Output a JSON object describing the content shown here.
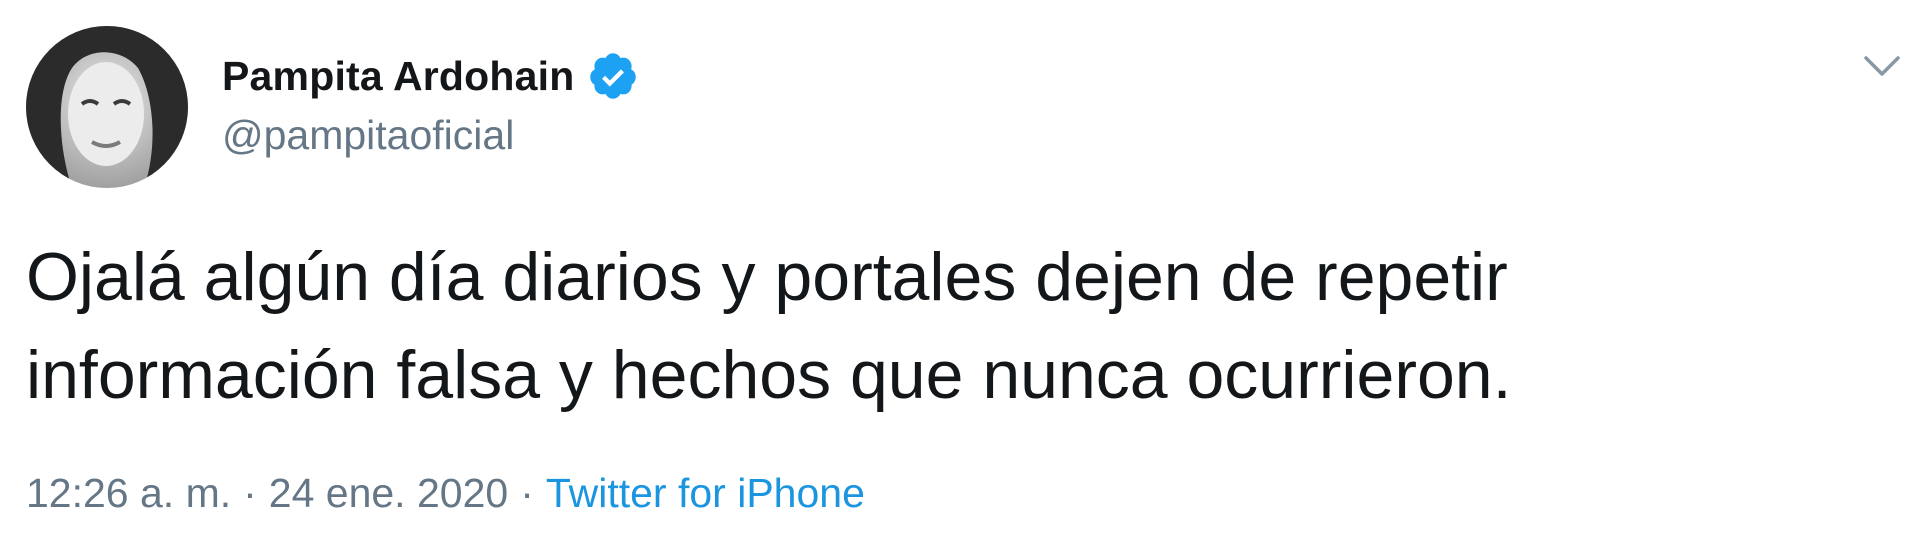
{
  "user": {
    "display_name": "Pampita Ardohain",
    "handle": "@pampitaoficial",
    "verified": true,
    "avatar_icon": "profile-photo-avatar"
  },
  "tweet": {
    "line1": "Ojalá algún día diarios y portales dejen de repetir",
    "line2": "información falsa y hechos que nunca ocurrieron."
  },
  "meta": {
    "time": "12:26 a. m.",
    "separator": "·",
    "date": "24 ene. 2020",
    "source": "Twitter for iPhone"
  },
  "menu": {
    "icon": "chevron-down-icon"
  },
  "colors": {
    "text": "#14171a",
    "secondary": "#657786",
    "link": "#1b95e0",
    "verified": "#1da1f2"
  }
}
